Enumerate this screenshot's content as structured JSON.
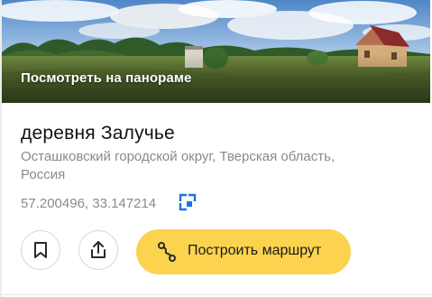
{
  "panorama": {
    "label": "Посмотреть на панораме"
  },
  "place": {
    "title": "деревня Залучье",
    "address": "Осташковский городской округ, Тверская область, Россия",
    "coordinates": "57.200496, 33.147214"
  },
  "actions": {
    "bookmark_icon": "bookmark-icon",
    "share_icon": "share-icon",
    "route_label": "Построить маршрут",
    "route_icon": "route-icon"
  },
  "colors": {
    "accent": "#fcd34f",
    "coords_icon": "#1a73e8",
    "secondary_text": "#8a8a8a"
  }
}
